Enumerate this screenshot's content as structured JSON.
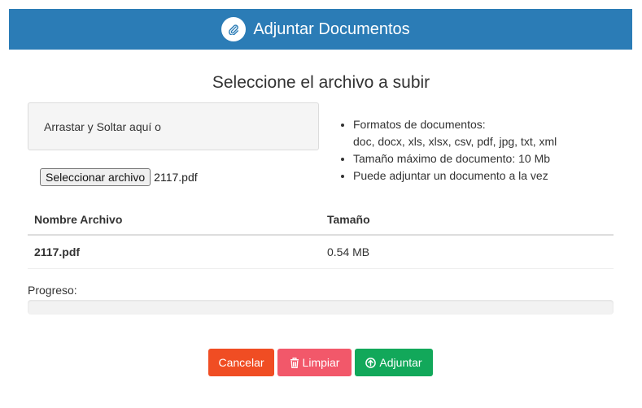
{
  "header": {
    "title": "Adjuntar Documentos",
    "icon": "paperclip-icon"
  },
  "main_title": "Seleccione el archivo a subir",
  "dropzone": {
    "text": "Arrastar y Soltar aquí o"
  },
  "file_input": {
    "button_label": "Seleccionar archivo",
    "selected_file": "2117.pdf"
  },
  "info": {
    "items": [
      "Formatos de documentos:",
      "doc, docx, xls, xlsx, csv, pdf, jpg, txt, xml",
      "Tamaño máximo de documento: 10 Mb",
      "Puede adjuntar un documento a la vez"
    ]
  },
  "table": {
    "headers": [
      "Nombre Archivo",
      "Tamaño"
    ],
    "rows": [
      {
        "name": "2117.pdf",
        "size": "0.54 MB"
      }
    ]
  },
  "progress": {
    "label": "Progreso:",
    "value": 0
  },
  "buttons": {
    "cancel": "Cancelar",
    "clear": "Limpiar",
    "attach": "Adjuntar"
  },
  "colors": {
    "header": "#2b7cb6",
    "cancel": "#f04d23",
    "clear": "#f2586a",
    "attach": "#12a85a"
  }
}
